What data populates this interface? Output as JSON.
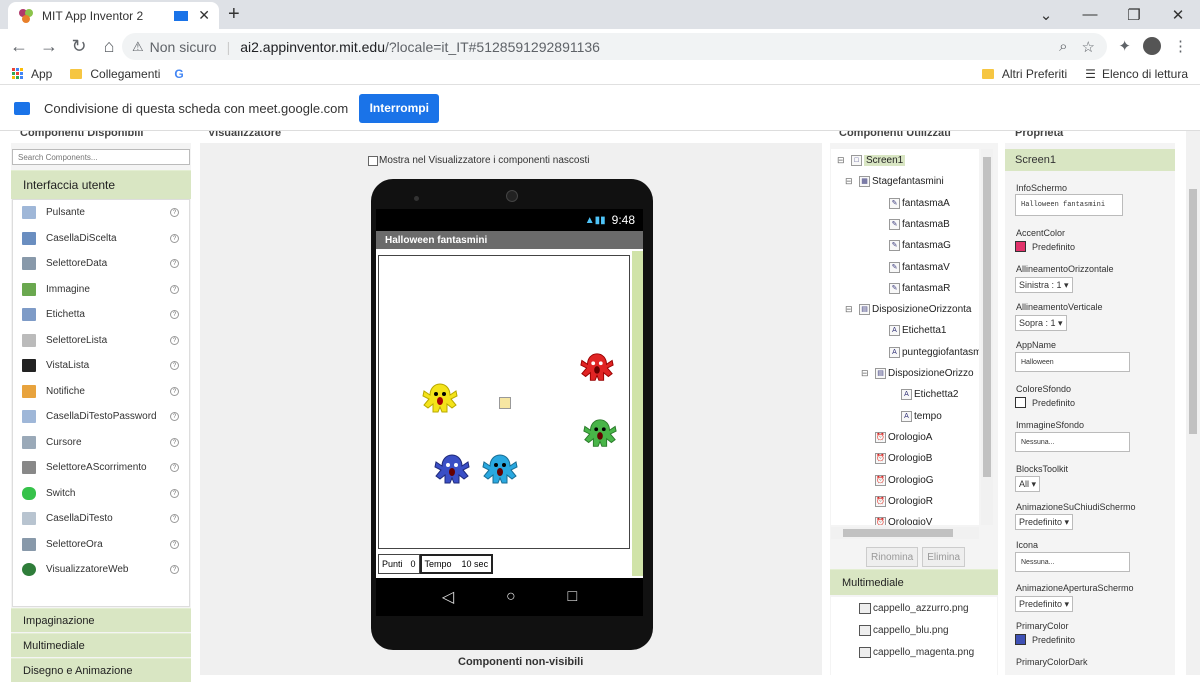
{
  "browser": {
    "tab_title": "MIT App Inventor 2",
    "not_secure": "Non sicuro",
    "url_host": "ai2.appinventor.mit.edu",
    "url_rest": "/?locale=it_IT#5128591292891136",
    "bookmarks": {
      "apps": "App",
      "collegamenti": "Collegamenti",
      "google": "G",
      "altri": "Altri Preferiti",
      "elenco": "Elenco di lettura"
    }
  },
  "sharebar": {
    "text": "Condivisione di questa scheda con meet.google.com",
    "stop": "Interrompi"
  },
  "headers": {
    "palette": "Componenti Disponibili",
    "viewer": "Visualizzatore",
    "components": "Componenti Utilizzati",
    "properties": "Proprietà"
  },
  "palette": {
    "search_placeholder": "Search Components...",
    "section": "Interfaccia utente",
    "items": [
      {
        "label": "Pulsante",
        "icon": "button-icon",
        "color": "#9fb7d8"
      },
      {
        "label": "CasellaDiScelta",
        "icon": "checkbox-icon",
        "color": "#6a8ec0"
      },
      {
        "label": "SelettoreData",
        "icon": "datepicker-icon",
        "color": "#8899aa"
      },
      {
        "label": "Immagine",
        "icon": "image-icon",
        "color": "#6aa84f"
      },
      {
        "label": "Etichetta",
        "icon": "label-icon",
        "color": "#7e9bc7"
      },
      {
        "label": "SelettoreLista",
        "icon": "listpicker-icon",
        "color": "#bbbbbb"
      },
      {
        "label": "VistaLista",
        "icon": "listview-icon",
        "color": "#222222"
      },
      {
        "label": "Notifiche",
        "icon": "notifier-icon",
        "color": "#e8a33d"
      },
      {
        "label": "CasellaDiTestoPassword",
        "icon": "password-icon",
        "color": "#9fb7d8"
      },
      {
        "label": "Cursore",
        "icon": "slider-icon",
        "color": "#9aa9b8"
      },
      {
        "label": "SelettoreAScorrimento",
        "icon": "spinner-icon",
        "color": "#888888"
      },
      {
        "label": "Switch",
        "icon": "switch-icon",
        "color": "#36c24a"
      },
      {
        "label": "CasellaDiTesto",
        "icon": "textbox-icon",
        "color": "#b8c4d0"
      },
      {
        "label": "SelettoreOra",
        "icon": "timepicker-icon",
        "color": "#8899aa"
      },
      {
        "label": "VisualizzatoreWeb",
        "icon": "webviewer-icon",
        "color": "#2f7d3a"
      }
    ],
    "footer": [
      "Impaginazione",
      "Multimediale",
      "Disegno e Animazione"
    ]
  },
  "viewer": {
    "checkbox_label": "Mostra nel Visualizzatore i componenti nascosti",
    "time": "9:48",
    "app_title": "Halloween fantasmini",
    "punti_label": "Punti",
    "punti_value": "0",
    "tempo_label": "Tempo",
    "tempo_value": "10 sec",
    "nonvisible": "Componenti non-visibili",
    "monsters": [
      {
        "name": "fantasmaG",
        "color": "#f4e31a"
      },
      {
        "name": "fantasmaR",
        "color": "#e02424"
      },
      {
        "name": "fantasmaV",
        "color": "#48b548"
      },
      {
        "name": "fantasmaB",
        "color": "#3a4fc6"
      },
      {
        "name": "fantasmaA",
        "color": "#29a8e0"
      }
    ]
  },
  "tree": {
    "nodes": [
      {
        "label": "Screen1",
        "expander": "⊟"
      },
      {
        "label": "Stagefantasmini",
        "expander": "⊟"
      },
      {
        "label": "fantasmaA",
        "expander": ""
      },
      {
        "label": "fantasmaB",
        "expander": ""
      },
      {
        "label": "fantasmaG",
        "expander": ""
      },
      {
        "label": "fantasmaV",
        "expander": ""
      },
      {
        "label": "fantasmaR",
        "expander": ""
      },
      {
        "label": "DisposizioneOrizzonta",
        "expander": "⊟"
      },
      {
        "label": "Etichetta1",
        "expander": ""
      },
      {
        "label": "punteggiofantasmi",
        "expander": ""
      },
      {
        "label": "DisposizioneOrizzo",
        "expander": "⊟"
      },
      {
        "label": "Etichetta2",
        "expander": ""
      },
      {
        "label": "tempo",
        "expander": ""
      },
      {
        "label": "OrologioA",
        "expander": ""
      },
      {
        "label": "OrologioB",
        "expander": ""
      },
      {
        "label": "OrologioG",
        "expander": ""
      },
      {
        "label": "OrologioR",
        "expander": ""
      },
      {
        "label": "OrologioV",
        "expander": ""
      }
    ],
    "rename": "Rinomina",
    "delete": "Elimina"
  },
  "media": {
    "header": "Multimediale",
    "files": [
      "cappello_azzurro.png",
      "cappello_blu.png",
      "cappello_magenta.png"
    ]
  },
  "props": {
    "component": "Screen1",
    "info_label": "InfoSchermo",
    "info_value": "Halloween fantasmini",
    "accent_label": "AccentColor",
    "accent_value": "Predefinito",
    "accent_color": "#e2336b",
    "halign_label": "AllineamentoOrizzontale",
    "halign_value": "Sinistra : 1 ▾",
    "valign_label": "AllineamentoVerticale",
    "valign_value": "Sopra : 1 ▾",
    "appname_label": "AppName",
    "appname_value": "Halloween",
    "bg_label": "ColoreSfondo",
    "bg_value": "Predefinito",
    "bg_color": "#ffffff",
    "bgimg_label": "ImmagineSfondo",
    "bgimg_value": "Nessuna...",
    "blocks_label": "BlocksToolkit",
    "blocks_value": "All ▾",
    "closeanim_label": "AnimazioneSuChiudiSchermo",
    "closeanim_value": "Predefinito ▾",
    "icon_label": "Icona",
    "icon_value": "Nessuna...",
    "openanim_label": "AnimazioneAperturaSchermo",
    "openanim_value": "Predefinito ▾",
    "primary_label": "PrimaryColor",
    "primary_value": "Predefinito",
    "primary_color": "#3f51b5",
    "primarydark_label": "PrimaryColorDark"
  }
}
